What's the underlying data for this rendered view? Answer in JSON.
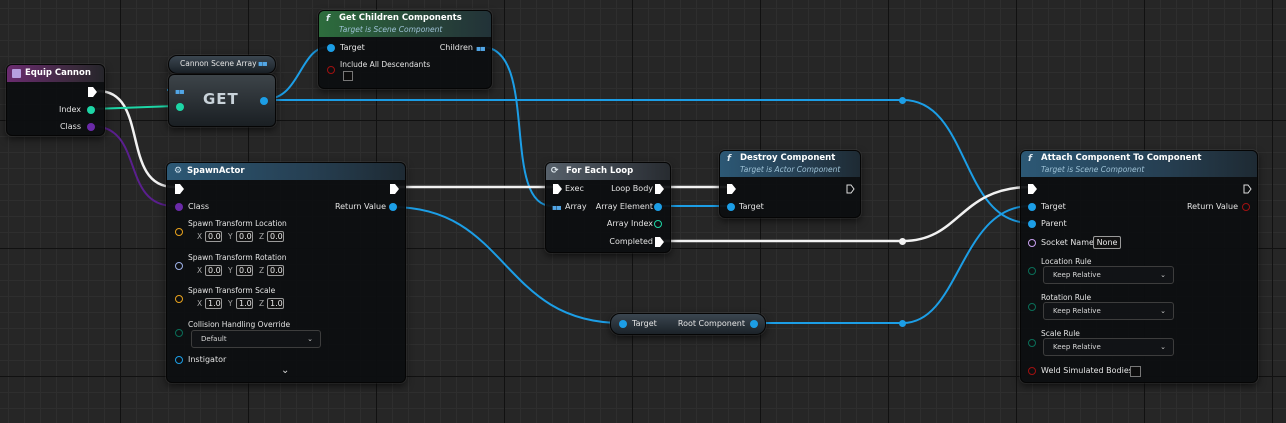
{
  "colors": {
    "exec": "#ffffff",
    "object": "#1c9ee6",
    "integer": "#1dd6a6",
    "class": "#6a2aa8",
    "transform": "#e8a21d",
    "rotator": "#9db1e8",
    "enum": "#0a6e58",
    "name": "#c8a0f0",
    "bool": "#8c0000"
  },
  "icons": {
    "function": "f",
    "event": "event-square-icon",
    "loop": "loop-icon",
    "exec": "exec-triangle-icon",
    "array": "array-grid-icon"
  },
  "event_node": {
    "title": "Equip Cannon",
    "index_label": "Index",
    "class_label": "Class"
  },
  "var_node": {
    "label": "Cannon Scene Array"
  },
  "get_node": {
    "label": "GET"
  },
  "get_children": {
    "title": "Get Children Components",
    "subtitle": "Target is Scene Component",
    "target_label": "Target",
    "children_label": "Children",
    "include_label": "Include All Descendants"
  },
  "spawn_actor": {
    "title": "SpawnActor",
    "class_label": "Class",
    "return_label": "Return Value",
    "location_label": "Spawn Transform Location",
    "rotation_label": "Spawn Transform Rotation",
    "scale_label": "Spawn Transform Scale",
    "axis_x": "X",
    "axis_y": "Y",
    "axis_z": "Z",
    "location": [
      "0.0",
      "0.0",
      "0.0"
    ],
    "rotation": [
      "0.0",
      "0.0",
      "0.0"
    ],
    "scale": [
      "1.0",
      "1.0",
      "1.0"
    ],
    "collision_label": "Collision Handling Override",
    "collision_value": "Default",
    "instigator_label": "Instigator",
    "expand_glyph": "⌄"
  },
  "for_each": {
    "title": "For Each Loop",
    "exec_label": "Exec",
    "array_label": "Array",
    "loop_body_label": "Loop Body",
    "array_element_label": "Array Element",
    "array_index_label": "Array Index",
    "completed_label": "Completed"
  },
  "destroy": {
    "title": "Destroy Component",
    "subtitle": "Target is Actor Component",
    "target_label": "Target"
  },
  "root_comp": {
    "target_label": "Target",
    "output_label": "Root Component"
  },
  "attach": {
    "title": "Attach Component To Component",
    "subtitle": "Target is Scene Component",
    "target_label": "Target",
    "parent_label": "Parent",
    "return_label": "Return Value",
    "socket_label": "Socket Name",
    "socket_value": "None",
    "location_rule_label": "Location Rule",
    "location_rule_value": "Keep Relative",
    "rotation_rule_label": "Rotation Rule",
    "rotation_rule_value": "Keep Relative",
    "scale_rule_label": "Scale Rule",
    "scale_rule_value": "Keep Relative",
    "weld_label": "Weld Simulated Bodies"
  }
}
